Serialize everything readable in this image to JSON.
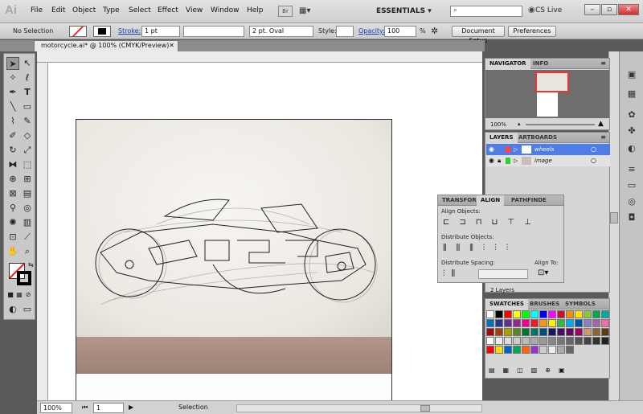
{
  "app": {
    "logo": "Ai"
  },
  "menu": [
    "File",
    "Edit",
    "Object",
    "Type",
    "Select",
    "Effect",
    "View",
    "Window",
    "Help"
  ],
  "menubar": {
    "bridge_label": "Br",
    "workspace": "ESSENTIALS",
    "cs_live": "CS Live"
  },
  "controlbar": {
    "selection": "No Selection",
    "stroke_label": "Stroke:",
    "stroke_value": "1 pt",
    "brush_value": "2 pt. Oval",
    "style_label": "Style:",
    "opacity_label": "Opacity:",
    "opacity_value": "100",
    "percent": "%",
    "document_setup": "Document Setup",
    "preferences": "Preferences"
  },
  "document": {
    "tab_title": "motorcycle.ai* @ 100% (CMYK/Preview)"
  },
  "status": {
    "zoom": "100%",
    "page": "1",
    "mode": "Selection"
  },
  "navigator": {
    "tabs": [
      "NAVIGATOR",
      "INFO"
    ],
    "zoom": "100%"
  },
  "layers": {
    "tabs": [
      "LAYERS",
      "ARTBOARDS"
    ],
    "items": [
      {
        "name": "wheels",
        "selected": true,
        "color": "#4f7de6"
      },
      {
        "name": "image",
        "selected": false,
        "color": "#e64f4f"
      }
    ],
    "count": "2 Layers"
  },
  "align": {
    "tabs": [
      "TRANSFOR",
      "ALIGN",
      "PATHFINDE"
    ],
    "align_objects": "Align Objects:",
    "distribute_objects": "Distribute Objects:",
    "distribute_spacing": "Distribute Spacing:",
    "align_to": "Align To:"
  },
  "swatches": {
    "tabs": [
      "SWATCHES",
      "BRUSHES",
      "SYMBOLS"
    ],
    "colors": [
      "#ffffff",
      "#000000",
      "#ff0000",
      "#ffff00",
      "#00ff00",
      "#00ffff",
      "#0000ff",
      "#ff00ff",
      "#c8102e",
      "#f39200",
      "#ffe600",
      "#8dc63f",
      "#00a651",
      "#00a99d",
      "#0072bc",
      "#2e3192",
      "#662d91",
      "#92278f",
      "#ec008c",
      "#ed1c24",
      "#f7941d",
      "#fff200",
      "#39b54a",
      "#00aeef",
      "#0054a6",
      "#8781bd",
      "#a864a8",
      "#f06eaa",
      "#9e0b0f",
      "#a0410d",
      "#aba000",
      "#598527",
      "#007236",
      "#00746b",
      "#004a80",
      "#1b1464",
      "#440e62",
      "#630460",
      "#9e005d",
      "#c69c6d",
      "#8c6239",
      "#603913",
      "#ffffff",
      "#eeeeee",
      "#dddddd",
      "#cccccc",
      "#bbbbbb",
      "#aaaaaa",
      "#999999",
      "#888888",
      "#777777",
      "#666666",
      "#555555",
      "#444444",
      "#333333",
      "#222222",
      "#ff0000",
      "#ffdd00",
      "#0066cc",
      "#00aa55",
      "#ff6600",
      "#9933cc",
      "#cccccc",
      "#eeeeee",
      "#aaaaaa",
      "#666666"
    ]
  }
}
